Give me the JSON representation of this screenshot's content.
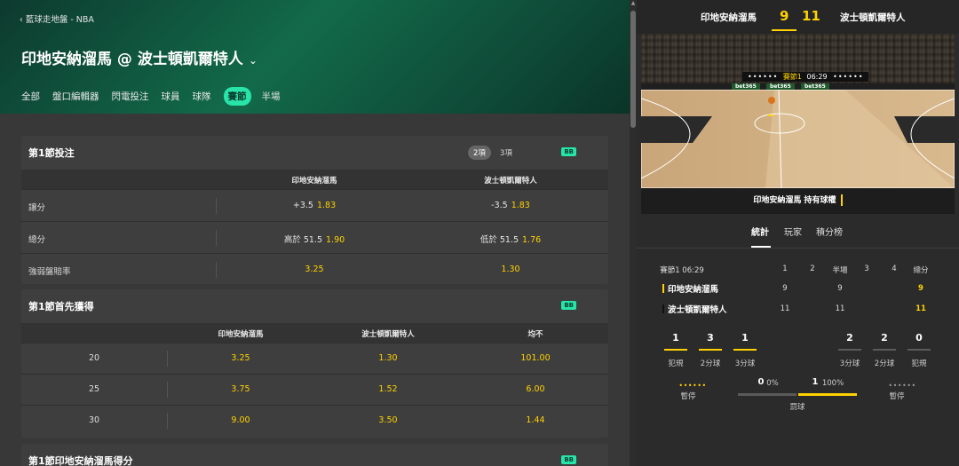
{
  "breadcrumb": "藍球走地盤 - NBA",
  "match_title": "印地安納溜馬 @ 波士頓凱爾特人",
  "tabs": [
    "全部",
    "盤口編輯器",
    "閃電投注",
    "球員",
    "球隊",
    "賽節",
    "半場"
  ],
  "active_tab": "賽節",
  "badge_label": "BB",
  "panel1": {
    "title": "第1節投注",
    "toggle": [
      "2項",
      "3項"
    ],
    "col_headers": [
      "印地安納溜馬",
      "波士頓凱爾特人"
    ],
    "rows": [
      {
        "label": "讓分",
        "a_pre": "+3.5",
        "a_odd": "1.83",
        "b_pre": "-3.5",
        "b_odd": "1.83"
      },
      {
        "label": "總分",
        "a_pre": "高於 51.5",
        "a_odd": "1.90",
        "b_pre": "低於 51.5",
        "b_odd": "1.76"
      },
      {
        "label": "強弱盤賠率",
        "a_pre": "",
        "a_odd": "3.25",
        "b_pre": "",
        "b_odd": "1.30"
      }
    ]
  },
  "panel2": {
    "title": "第1節首先獲得",
    "col_headers": [
      "印地安納溜馬",
      "波士頓凱爾特人",
      "均不"
    ],
    "rows": [
      {
        "num": "20",
        "values": [
          "3.25",
          "1.30",
          "101.00"
        ]
      },
      {
        "num": "25",
        "values": [
          "3.75",
          "1.52",
          "6.00"
        ]
      },
      {
        "num": "30",
        "values": [
          "9.00",
          "3.50",
          "1.44"
        ]
      }
    ]
  },
  "panel3": {
    "title": "第1節印地安納溜馬得分"
  },
  "scoreboard": {
    "team_a": "印地安納溜馬",
    "team_b": "波士頓凱爾特人",
    "score_a": "9",
    "score_b": "11",
    "clock_dots": "••••••",
    "clock_quarter": "賽節1",
    "clock_time": "06:29",
    "ad_text": "bet365",
    "possession_text": "印地安納溜馬 持有球權"
  },
  "stat_tabs": [
    "統計",
    "玩家",
    "積分榜"
  ],
  "active_stat_tab": "統計",
  "box": {
    "period_label": "賽節1 06:29",
    "headers": [
      "1",
      "2",
      "半場",
      "3",
      "4",
      "總分"
    ],
    "teams": [
      {
        "name": "印地安納溜馬",
        "marker_color": "#ffd200",
        "q": [
          "9",
          "",
          "9",
          "",
          "",
          "9"
        ]
      },
      {
        "name": "波士頓凱爾特人",
        "marker_color": "#111111",
        "q": [
          "11",
          "",
          "11",
          "",
          "",
          "11"
        ]
      }
    ]
  },
  "team_stats": {
    "left": [
      {
        "value": "1",
        "label": "犯規"
      },
      {
        "value": "3",
        "label": "2分球"
      },
      {
        "value": "1",
        "label": "3分球"
      }
    ],
    "right": [
      {
        "value": "2",
        "label": "3分球"
      },
      {
        "value": "2",
        "label": "2分球"
      },
      {
        "value": "0",
        "label": "犯規"
      }
    ],
    "timeouts_left": "••••••",
    "timeouts_right": "••••••",
    "timeout_label": "暫停",
    "poss_a_count": "0",
    "poss_a_pct": "0%",
    "poss_b_count": "1",
    "poss_b_pct": "100%",
    "poss_a_fraction": 0,
    "poss_b_fraction": 1,
    "poss_label": "罰球"
  },
  "colors": {
    "accent": "#27e5a8",
    "odds": "#ffd200",
    "header_green": "#126a4a"
  }
}
